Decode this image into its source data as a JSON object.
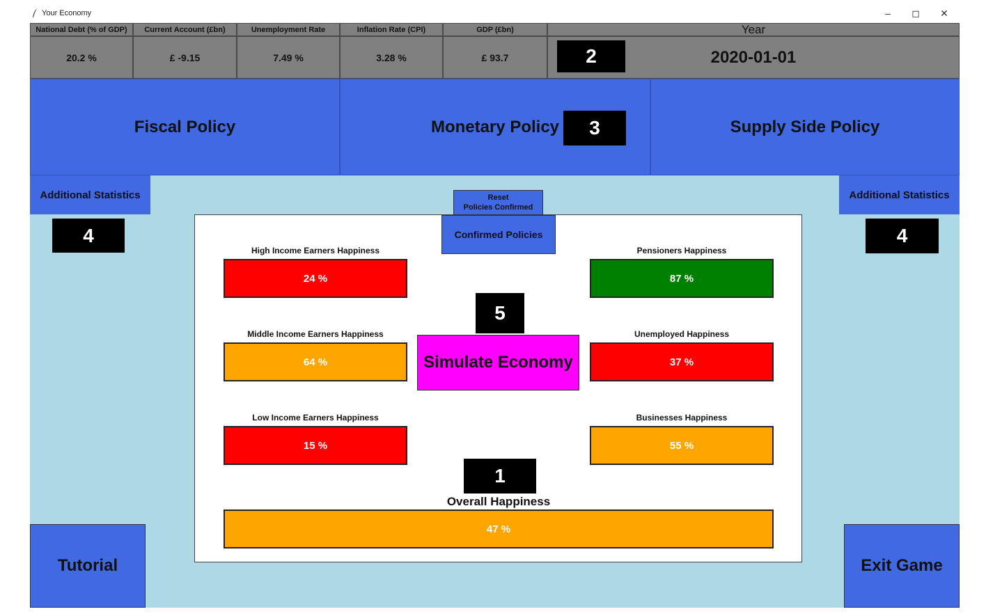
{
  "window": {
    "title": "Your Economy",
    "minimize": "–",
    "maximize": "◻",
    "close": "✕"
  },
  "stats": [
    {
      "header": "National Debt (% of GDP)",
      "value": "20.2 %"
    },
    {
      "header": "Current Account (£bn)",
      "value": "£ -9.15"
    },
    {
      "header": "Unemployment Rate",
      "value": "7.49 %"
    },
    {
      "header": "Inflation Rate (CPI)",
      "value": "3.28 %"
    },
    {
      "header": "GDP (£bn)",
      "value": "£ 93.7"
    }
  ],
  "year": {
    "label": "Year",
    "value": "2020-01-01"
  },
  "policies": [
    "Fiscal Policy",
    "Monetary Policy",
    "Supply Side Policy"
  ],
  "additional_statistics": "Additional Statistics",
  "reset": {
    "line1": "Reset",
    "line2": "Policies Confirmed"
  },
  "confirmed_policies": "Confirmed Policies",
  "simulate": "Simulate Economy",
  "groups": {
    "high": {
      "label": "High Income Earners Happiness",
      "value": "24 %",
      "color": "#ff0000"
    },
    "middle": {
      "label": "Middle Income Earners Happiness",
      "value": "64 %",
      "color": "#ffa500"
    },
    "low": {
      "label": "Low Income Earners Happiness",
      "value": "15 %",
      "color": "#ff0000"
    },
    "pensioners": {
      "label": "Pensioners Happiness",
      "value": "87 %",
      "color": "#008000"
    },
    "unemployed": {
      "label": "Unemployed Happiness",
      "value": "37 %",
      "color": "#ff0000"
    },
    "businesses": {
      "label": "Businesses Happiness",
      "value": "55 %",
      "color": "#ffa500"
    }
  },
  "overall": {
    "label": "Overall Happiness",
    "value": "47 %",
    "color": "#ffa500"
  },
  "tutorial": "Tutorial",
  "exit": "Exit Game",
  "badges": {
    "b1": "1",
    "b2": "2",
    "b3": "3",
    "b4": "4",
    "b5": "5"
  }
}
